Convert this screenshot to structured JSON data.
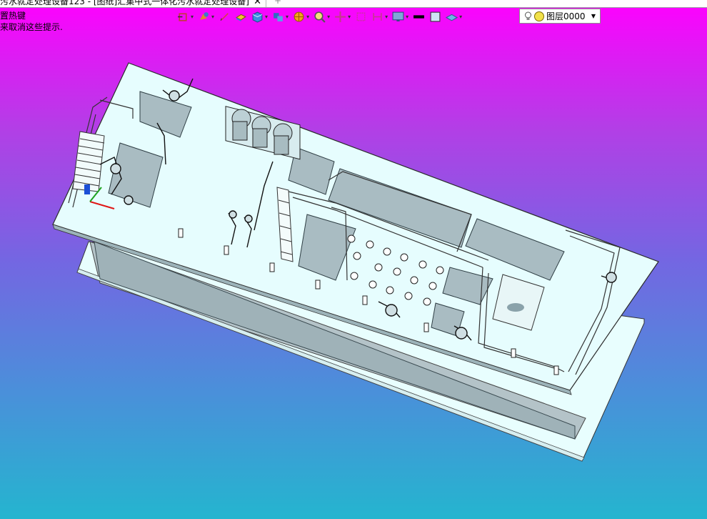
{
  "tab": {
    "title": "污水就定处理设备123 - [图纸]汇集中式一体化污水就定处理设备]",
    "close": "✕",
    "new_tab": "+"
  },
  "hints": {
    "line1": "置热键",
    "line2": "来取消这些提示."
  },
  "toolbar": {
    "tools": [
      {
        "name": "view-orient-icon",
        "has_menu": true
      },
      {
        "name": "view-style-icon",
        "has_menu": true
      },
      {
        "name": "pencil-icon",
        "has_menu": false
      },
      {
        "name": "part-icon",
        "has_menu": false
      },
      {
        "name": "cube-icon",
        "has_menu": true
      },
      {
        "name": "assembly-icon",
        "has_menu": true
      },
      {
        "name": "render-icon",
        "has_menu": true
      },
      {
        "name": "zoom-icon",
        "has_menu": true
      },
      {
        "name": "move-icon",
        "has_menu": true
      },
      {
        "name": "section-icon",
        "has_menu": false
      },
      {
        "name": "measure-icon",
        "has_menu": true
      },
      {
        "name": "display-icon",
        "has_menu": true
      },
      {
        "name": "line-color-icon",
        "has_menu": false
      },
      {
        "name": "fill-color-icon",
        "has_menu": false
      },
      {
        "name": "layer-manager-icon",
        "has_menu": true
      }
    ],
    "accent": "#1a73c7"
  },
  "layer": {
    "name": "图层0000"
  },
  "viewport": {
    "background_top": "#ff00ff",
    "background_bottom": "#24b5cf"
  }
}
